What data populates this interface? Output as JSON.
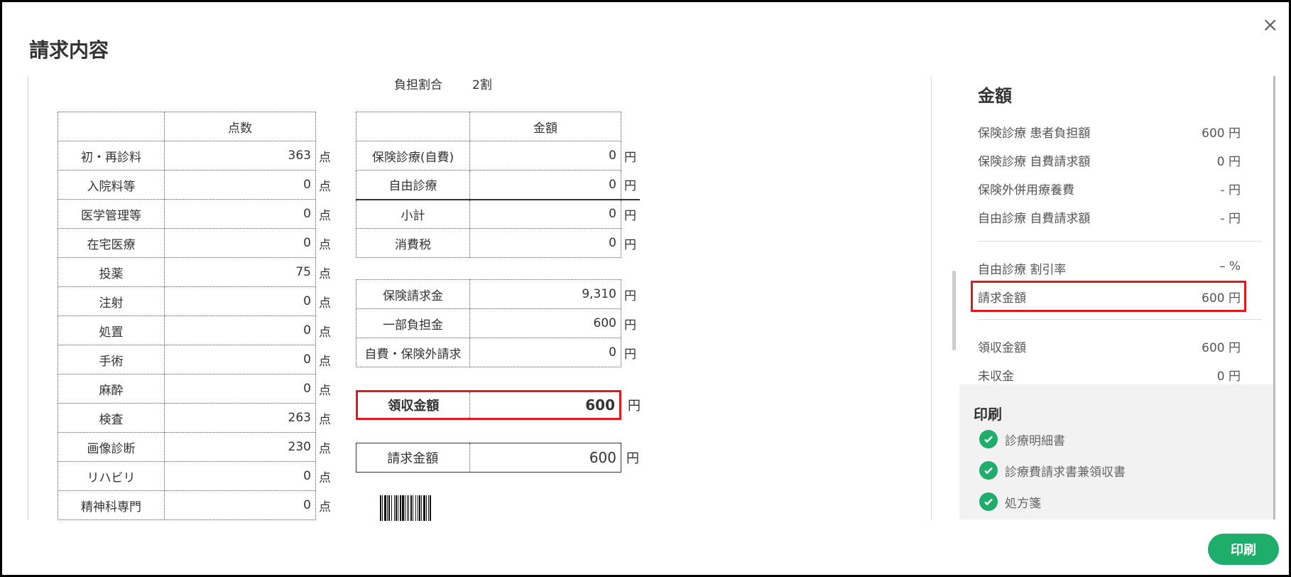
{
  "dialog": {
    "title": "請求内容",
    "close_label": "×",
    "print_button": "印刷"
  },
  "document": {
    "burden_label": "負担割合",
    "burden_value": "2割",
    "points_table": {
      "header": "点数",
      "unit": "点",
      "rows": [
        {
          "label": "初・再診料",
          "value": "363"
        },
        {
          "label": "入院料等",
          "value": "0"
        },
        {
          "label": "医学管理等",
          "value": "0"
        },
        {
          "label": "在宅医療",
          "value": "0"
        },
        {
          "label": "投薬",
          "value": "75"
        },
        {
          "label": "注射",
          "value": "0"
        },
        {
          "label": "処置",
          "value": "0"
        },
        {
          "label": "手術",
          "value": "0"
        },
        {
          "label": "麻酔",
          "value": "0"
        },
        {
          "label": "検査",
          "value": "263"
        },
        {
          "label": "画像診断",
          "value": "230"
        },
        {
          "label": "リハビリ",
          "value": "0"
        },
        {
          "label": "精神科専門",
          "value": "0"
        }
      ]
    },
    "amount_table": {
      "header": "金額",
      "unit": "円",
      "rows": [
        {
          "label": "保険診療(自費)",
          "value": "0"
        },
        {
          "label": "自由診療",
          "value": "0"
        },
        {
          "label": "小計",
          "value": "0"
        },
        {
          "label": "消費税",
          "value": "0"
        }
      ]
    },
    "claim_table": {
      "unit": "円",
      "rows": [
        {
          "label": "保険請求金",
          "value": "9,310"
        },
        {
          "label": "一部負担金",
          "value": "600"
        },
        {
          "label": "自費・保険外請求",
          "value": "0"
        }
      ]
    },
    "received": {
      "label": "領収金額",
      "value": "600",
      "unit": "円"
    },
    "billed": {
      "label": "請求金額",
      "value": "600",
      "unit": "円"
    }
  },
  "summary": {
    "title": "金額",
    "rows_a": [
      {
        "label": "保険診療 患者負担額",
        "value": "600 円"
      },
      {
        "label": "保険診療 自費請求額",
        "value": "0 円"
      },
      {
        "label": "保険外併用療養費",
        "value": "- 円"
      },
      {
        "label": "自由診療 自費請求額",
        "value": "- 円"
      }
    ],
    "rows_b": [
      {
        "label": "自由診療 割引率",
        "value": "– %"
      },
      {
        "label": "請求金額",
        "value": "600 円"
      }
    ],
    "rows_c": [
      {
        "label": "領収金額",
        "value": "600 円"
      },
      {
        "label": "未収金",
        "value": "0 円"
      }
    ]
  },
  "print": {
    "title": "印刷",
    "items": [
      "診療明細書",
      "診療費請求書兼領収書",
      "処方箋"
    ]
  },
  "colors": {
    "accent": "#1fad6b",
    "highlight": "#e0191c"
  }
}
